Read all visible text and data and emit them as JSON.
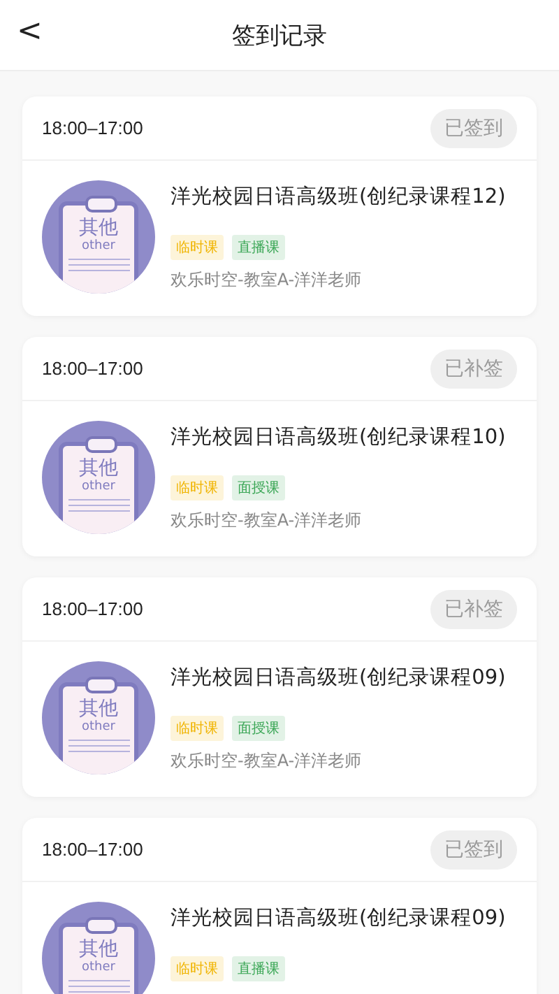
{
  "header": {
    "back": "<",
    "title": "签到记录"
  },
  "records": [
    {
      "time": "18:00–17:00",
      "status": "已签到",
      "avatar_label": "其他",
      "avatar_sublabel": "other",
      "title": "洋光校园日语高级班(创纪录课程12)",
      "tags": [
        {
          "label": "临时课",
          "color": "#f0b400"
        },
        {
          "label": "直播课",
          "color": "#3aa655"
        }
      ],
      "info": "欢乐时空-教室A-洋洋老师"
    },
    {
      "time": "18:00–17:00",
      "status": "已补签",
      "avatar_label": "其他",
      "avatar_sublabel": "other",
      "title": "洋光校园日语高级班(创纪录课程10)",
      "tags": [
        {
          "label": "临时课",
          "color": "#f0b400"
        },
        {
          "label": "面授课",
          "color": "#3aa655"
        }
      ],
      "info": "欢乐时空-教室A-洋洋老师"
    },
    {
      "time": "18:00–17:00",
      "status": "已补签",
      "avatar_label": "其他",
      "avatar_sublabel": "other",
      "title": "洋光校园日语高级班(创纪录课程09)",
      "tags": [
        {
          "label": "临时课",
          "color": "#f0b400"
        },
        {
          "label": "面授课",
          "color": "#3aa655"
        }
      ],
      "info": "欢乐时空-教室A-洋洋老师"
    },
    {
      "time": "18:00–17:00",
      "status": "已签到",
      "avatar_label": "其他",
      "avatar_sublabel": "other",
      "title": "洋光校园日语高级班(创纪录课程09)",
      "tags": [
        {
          "label": "临时课",
          "color": "#f0b400"
        },
        {
          "label": "直播课",
          "color": "#3aa655"
        }
      ]
    }
  ]
}
